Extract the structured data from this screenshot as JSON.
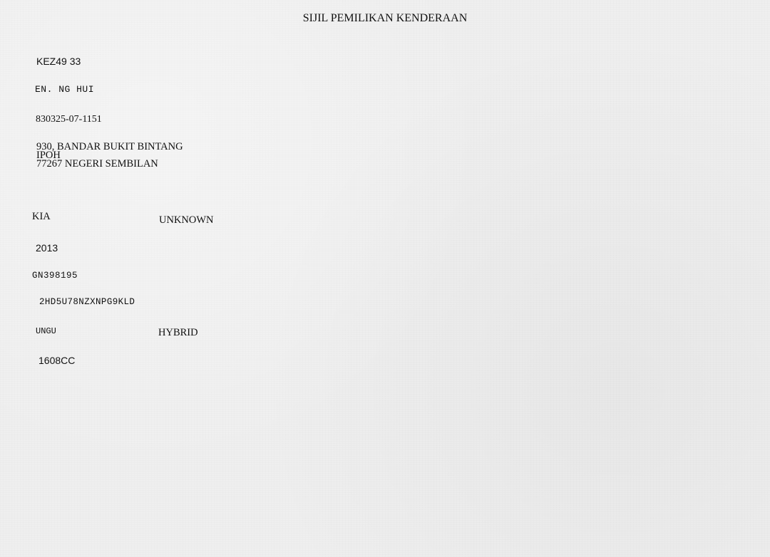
{
  "document": {
    "title": "SIJIL PEMILIKAN KENDERAAN",
    "owner": {
      "plate_number": "KEZ49 33",
      "name": "EN. NG HUI",
      "ic_number": "830325-07-1151",
      "address": {
        "line1": "930, BANDAR BUKIT BINTANG",
        "line2": "IPOH",
        "line3": "77267 NEGERI SEMBILAN"
      }
    },
    "vehicle": {
      "make": "KIA",
      "model": "UNKNOWN",
      "year": "2013",
      "engine_number": "GN398195",
      "chassis_number": "2HD5U78NZXNPG9KLD",
      "color": "UNGU",
      "fuel": "HYBRID",
      "engine_capacity": "1608CC"
    }
  }
}
